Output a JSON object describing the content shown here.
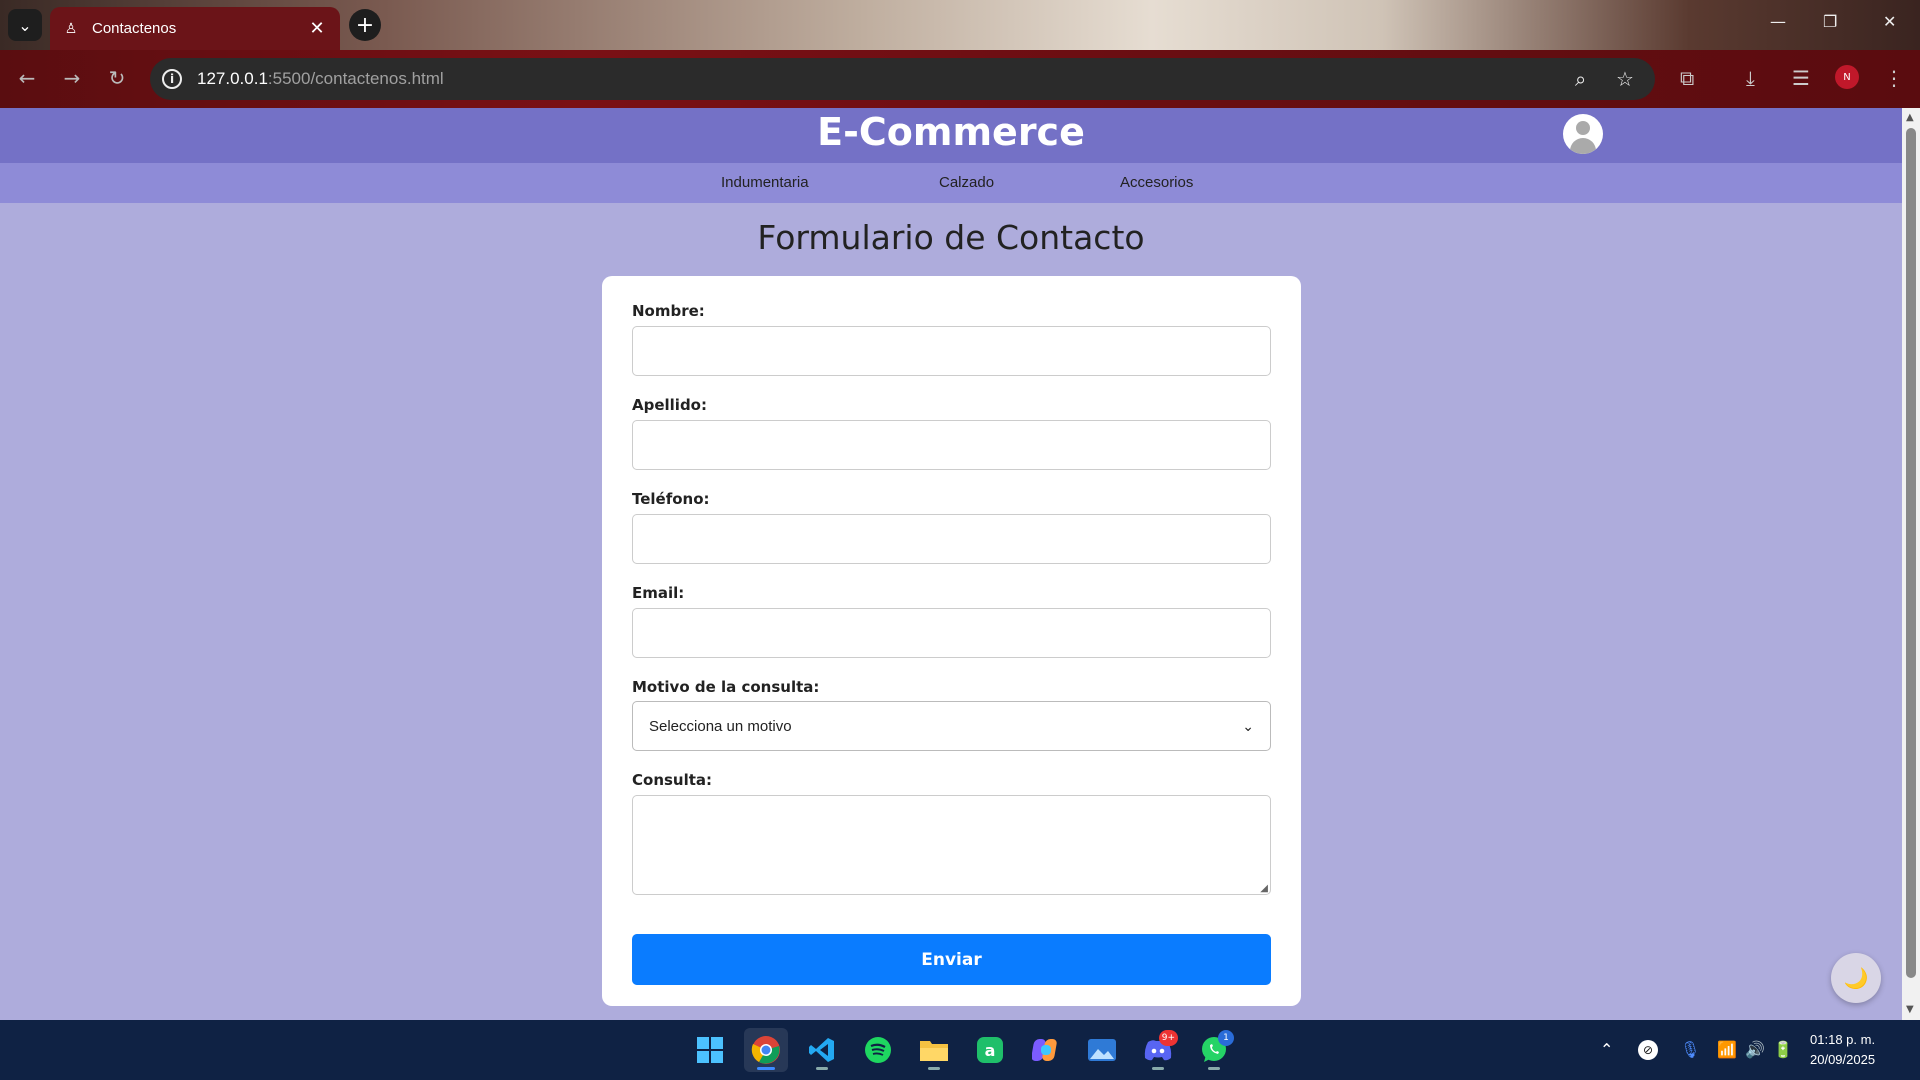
{
  "browser": {
    "tab": {
      "title": "Contactenos",
      "favicon": "person-icon",
      "close": "✕"
    },
    "new_tab": "+",
    "url": {
      "host": "127.0.0.1",
      "rest": ":5500/contactenos.html"
    },
    "window_controls": {
      "minimize": "—",
      "restore": "❐",
      "close": "✕"
    }
  },
  "site": {
    "title": "E-Commerce",
    "nav": [
      "Indumentaria",
      "Calzado",
      "Accesorios"
    ]
  },
  "form": {
    "title": "Formulario de Contacto",
    "fields": {
      "nombre": {
        "label": "Nombre:",
        "value": ""
      },
      "apellido": {
        "label": "Apellido:",
        "value": ""
      },
      "telefono": {
        "label": "Teléfono:",
        "value": ""
      },
      "email": {
        "label": "Email:",
        "value": ""
      },
      "motivo": {
        "label": "Motivo de la consulta:",
        "selected": "Selecciona un motivo"
      },
      "consulta": {
        "label": "Consulta:",
        "value": ""
      }
    },
    "submit_label": "Enviar"
  },
  "theme_toggle": {
    "icon": "moon-icon",
    "glyph": "🌙"
  },
  "taskbar": {
    "apps": [
      "start-icon",
      "chrome-icon",
      "vscode-icon",
      "spotify-icon",
      "file-explorer-icon",
      "app-a-icon",
      "copilot-icon",
      "photos-icon",
      "discord-icon",
      "whatsapp-icon"
    ],
    "discord_badge": "9+",
    "whatsapp_badge": "1",
    "time": "01:18 p. m.",
    "date": "20/09/2025"
  },
  "colors": {
    "header": "#7471c6",
    "nav": "#8e8bd7",
    "page_bg": "#aeacdc",
    "submit": "#0a7cff"
  }
}
